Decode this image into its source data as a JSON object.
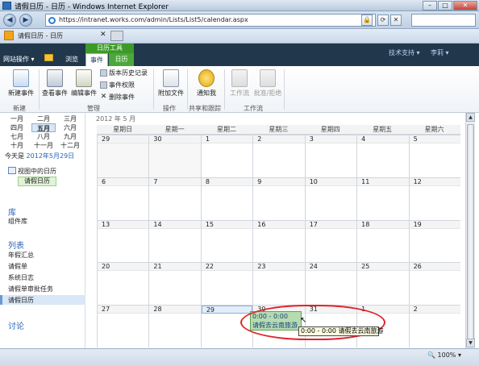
{
  "window": {
    "title": "请假日历 - 日历 - Windows Internet Explorer",
    "min_label": "–",
    "max_label": "□",
    "close_label": "✕"
  },
  "browser": {
    "back_glyph": "◀",
    "forward_glyph": "▶",
    "url": "https://intranet.works.com/admin/Lists/List5/calendar.aspx",
    "tab_title": "请假日历 - 日历",
    "tab_close": "✕",
    "zoom": "100%",
    "zoom_glyph": "▾"
  },
  "sharepoint": {
    "site_actions": "网站操作 ▾",
    "browse": "浏览",
    "context_group": "日历工具",
    "tab_event": "事件",
    "tab_calendar": "日历",
    "user_1": "技术支持 ▾",
    "user_2": "李莉 ▾"
  },
  "ribbon": {
    "new_event": "新建事件",
    "view_event": "查看事件",
    "edit_event": "编辑事件",
    "version_history": "版本历史记录",
    "event_permissions": "事件权限",
    "delete_event": "删除事件",
    "attach_file": "附加文件",
    "alert_me": "通知我",
    "workflows": "工作流",
    "approve_reject": "批准/拒绝",
    "group_new": "新建",
    "group_manage": "管理",
    "group_actions": "操作",
    "group_share": "共享和跟踪",
    "group_workflow": "工作流"
  },
  "navigator": {
    "months": [
      [
        "一月",
        "二月",
        "三月"
      ],
      [
        "四月",
        "五月",
        "六月"
      ],
      [
        "七月",
        "八月",
        "九月"
      ],
      [
        "十月",
        "十一月",
        "十二月"
      ]
    ],
    "selected_month": "五月",
    "today_prefix": "今天是",
    "today_date": "2012年5月29日",
    "view_label": "视图中的日历",
    "view_selected": "请假日历"
  },
  "quicklaunch": {
    "libraries_heading": "库",
    "libraries": [
      "组件库"
    ],
    "lists_heading": "列表",
    "lists": [
      "年假汇总",
      "请假单",
      "系统日志",
      "请假单审批任务",
      "请假日历"
    ],
    "discussions_heading": "讨论"
  },
  "calendar": {
    "month_label": "2012 年 5 月",
    "day_headers": [
      "星期日",
      "星期一",
      "星期二",
      "星期三",
      "星期四",
      "星期五",
      "星期六"
    ],
    "weeks": [
      [
        "29",
        "30",
        "1",
        "2",
        "3",
        "4",
        "5"
      ],
      [
        "6",
        "7",
        "8",
        "9",
        "10",
        "11",
        "12"
      ],
      [
        "13",
        "14",
        "15",
        "16",
        "17",
        "18",
        "19"
      ],
      [
        "20",
        "21",
        "22",
        "23",
        "24",
        "25",
        "26"
      ],
      [
        "27",
        "28",
        "29",
        "30",
        "31",
        "1",
        "2"
      ]
    ],
    "today_index": [
      4,
      2
    ],
    "event": {
      "time": "0:00 - 0:00",
      "title": "请假去云南旅游"
    },
    "tooltip": "0:00 - 0:00 请假去云南旅游"
  },
  "scrollbar": {
    "up_glyph": "▲",
    "down_glyph": "▼"
  },
  "colors": {
    "sharepoint_bar": "#21374c",
    "context_green": "#3d9a28",
    "event_fill": "#b6dbb0",
    "highlight_circle": "#e0242a"
  }
}
